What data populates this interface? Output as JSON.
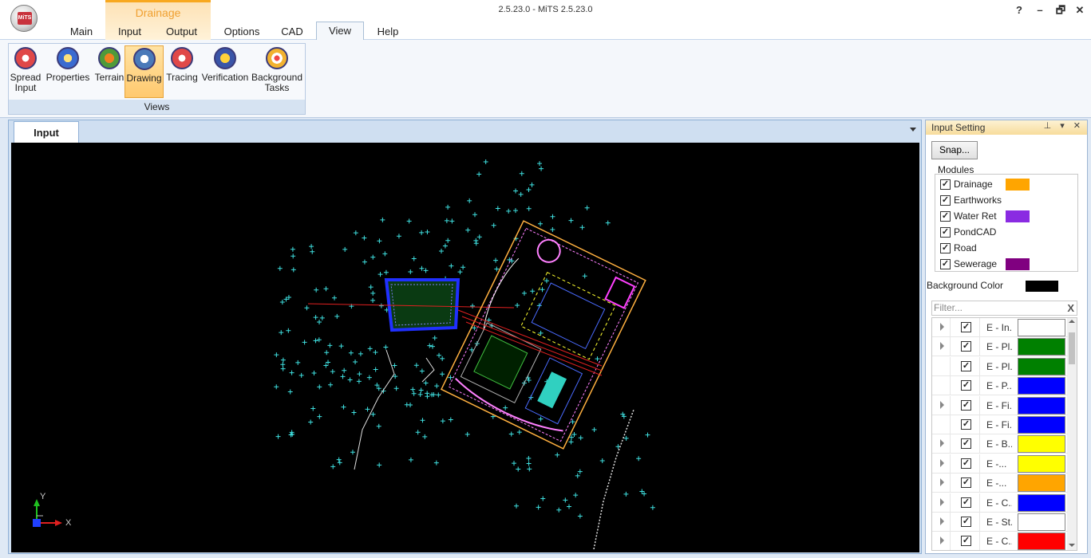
{
  "app": {
    "title": "2.5.23.0 - MiTS 2.5.23.0",
    "orb_text": "MiTS",
    "window_controls": [
      "?",
      "–",
      "🗗",
      "✕"
    ]
  },
  "ribbon": {
    "context_group": "Drainage",
    "tabs": [
      {
        "label": "Main",
        "active": false
      },
      {
        "label": "Input",
        "active": false
      },
      {
        "label": "Output",
        "active": false
      },
      {
        "label": "Options",
        "active": false
      },
      {
        "label": "CAD",
        "active": false
      },
      {
        "label": "View",
        "active": true
      },
      {
        "label": "Help",
        "active": false
      }
    ],
    "group_title": "Views",
    "buttons": [
      {
        "line1": "Spread",
        "line2": "Input",
        "icon": "spread-input-icon",
        "selected": false
      },
      {
        "line1": "Properties",
        "line2": "",
        "icon": "properties-icon",
        "selected": false
      },
      {
        "line1": "Terrain",
        "line2": "",
        "icon": "terrain-icon",
        "selected": false
      },
      {
        "line1": "Drawing",
        "line2": "",
        "icon": "drawing-icon",
        "selected": true
      },
      {
        "line1": "Tracing",
        "line2": "",
        "icon": "tracing-icon",
        "selected": false
      },
      {
        "line1": "Verification",
        "line2": "",
        "icon": "verification-icon",
        "selected": false
      },
      {
        "line1": "Background",
        "line2": "Tasks",
        "icon": "background-tasks-icon",
        "selected": false
      }
    ]
  },
  "document": {
    "tab_label": "Input",
    "axis": {
      "y": "Y",
      "x": "X"
    }
  },
  "panel": {
    "title": "Input Setting",
    "controls": "⊥ ▾ ✕",
    "snap_button": "Snap...",
    "modules_label": "Modules",
    "modules": [
      {
        "label": "Drainage",
        "checked": true,
        "color": "#ffa500"
      },
      {
        "label": "Earthworks",
        "checked": true,
        "color": ""
      },
      {
        "label": "Water Ret",
        "checked": true,
        "color": "#8a2be2"
      },
      {
        "label": "PondCAD",
        "checked": true,
        "color": ""
      },
      {
        "label": "Road",
        "checked": true,
        "color": ""
      },
      {
        "label": "Sewerage",
        "checked": true,
        "color": "#800080"
      }
    ],
    "background_color_label": "Background Color",
    "background_color": "#000000",
    "filter_placeholder": "Filter...",
    "filter_clear": "X",
    "layers": [
      {
        "name": "E - In...",
        "expandable": true,
        "checked": true,
        "color": "#ffffff"
      },
      {
        "name": "E - Pl...",
        "expandable": true,
        "checked": true,
        "color": "#008000"
      },
      {
        "name": "E - Pl...",
        "expandable": false,
        "checked": true,
        "color": "#008000"
      },
      {
        "name": "E - P...",
        "expandable": false,
        "checked": true,
        "color": "#0000ff"
      },
      {
        "name": "E - Fi...",
        "expandable": true,
        "checked": true,
        "color": "#0000ff"
      },
      {
        "name": "E - Fi...",
        "expandable": false,
        "checked": true,
        "color": "#0000ff"
      },
      {
        "name": "E - B...",
        "expandable": true,
        "checked": true,
        "color": "#ffff00"
      },
      {
        "name": "E -...",
        "expandable": true,
        "checked": true,
        "color": "#ffff00"
      },
      {
        "name": "E -...",
        "expandable": true,
        "checked": true,
        "color": "#ffa500"
      },
      {
        "name": "E - C...",
        "expandable": true,
        "checked": true,
        "color": "#0000ff"
      },
      {
        "name": "E - St...",
        "expandable": true,
        "checked": true,
        "color": "#ffffff"
      },
      {
        "name": "E - C...",
        "expandable": true,
        "checked": true,
        "color": "#ff0000"
      }
    ]
  }
}
